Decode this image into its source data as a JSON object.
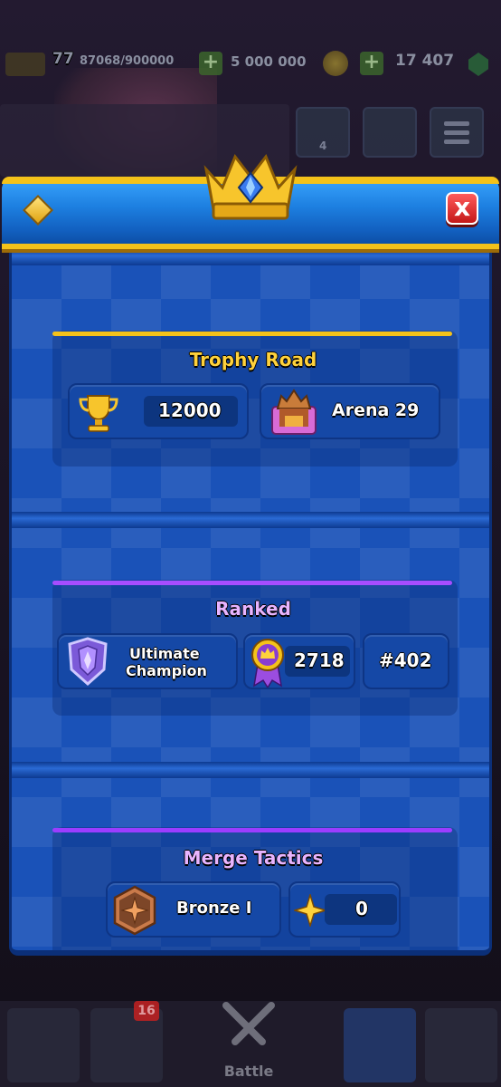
{
  "topbar": {
    "level": "77",
    "xp": "87068/900000",
    "gold": "5 000 000",
    "gems": "17 407"
  },
  "social": {
    "friends_count": "4"
  },
  "modal": {
    "close_icon": "x",
    "trophy_road": {
      "title": "Trophy Road",
      "trophies": "12000",
      "arena": "Arena 29"
    },
    "ranked": {
      "title": "Ranked",
      "league": "Ultimate Champion",
      "league_line1": "Ultimate",
      "league_line2": "Champion",
      "rating": "2718",
      "rank": "#402"
    },
    "merge_tactics": {
      "title": "Merge Tactics",
      "league": "Bronze I",
      "points": "0"
    }
  },
  "bottomnav": {
    "cards_badge": "16",
    "battle_label": "Battle"
  },
  "colors": {
    "trophy_line": "#f4c21a",
    "ranked_line": "#a64dff",
    "merge_line": "#9b3dff",
    "title_gold": "#ffd23c",
    "title_purple": "#e8b4ff"
  }
}
